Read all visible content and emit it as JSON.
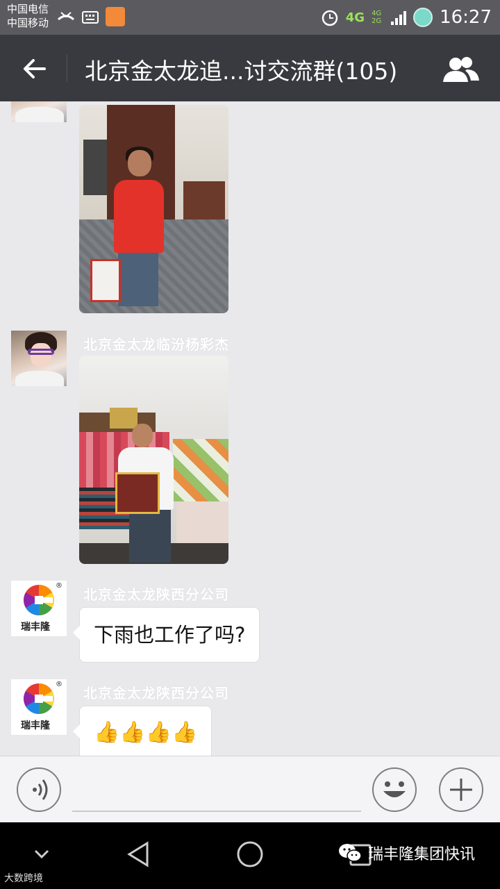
{
  "status_bar": {
    "carrier_1": "中国电信",
    "carrier_2": "中国移动",
    "network": "4G",
    "network_small": "4G 2G",
    "time": "16:27",
    "icons": [
      "missed-call-icon",
      "keyboard-icon",
      "app-icon",
      "alarm-icon",
      "signal-icon",
      "battery-icon"
    ]
  },
  "title_bar": {
    "back_icon": "back-arrow-icon",
    "title": "北京金太龙追...讨交流群(105)",
    "members_icon": "group-members-icon"
  },
  "messages": [
    {
      "type": "photo",
      "sender": "",
      "avatar": "avatar-photo",
      "description_icon": "photo-message"
    },
    {
      "type": "photo",
      "sender": "北京金太龙临汾杨彩杰",
      "avatar": "avatar-photo"
    },
    {
      "type": "text",
      "sender": "北京金太龙陕西分公司",
      "avatar": "ruifenglong-logo",
      "text": "下雨也工作了吗?"
    },
    {
      "type": "emoji",
      "sender": "北京金太龙陕西分公司",
      "avatar": "ruifenglong-logo",
      "text": "👍👍👍👍"
    }
  ],
  "logo": {
    "text": "瑞丰隆",
    "registered": "®",
    "colors": [
      "#e53935",
      "#fb8c00",
      "#fdd835",
      "#43a047",
      "#1e88e5",
      "#8e24aa"
    ]
  },
  "input_bar": {
    "voice_icon": "voice-input-icon",
    "emoji_icon": "emoji-icon",
    "plus_icon": "plus-icon",
    "placeholder": ""
  },
  "nav_bar": {
    "icons": [
      "collapse-icon",
      "back-nav-icon",
      "home-nav-icon",
      "recent-apps-icon"
    ],
    "watermark_right": "瑞丰隆集团快讯",
    "watermark_left": "大数跨境"
  }
}
